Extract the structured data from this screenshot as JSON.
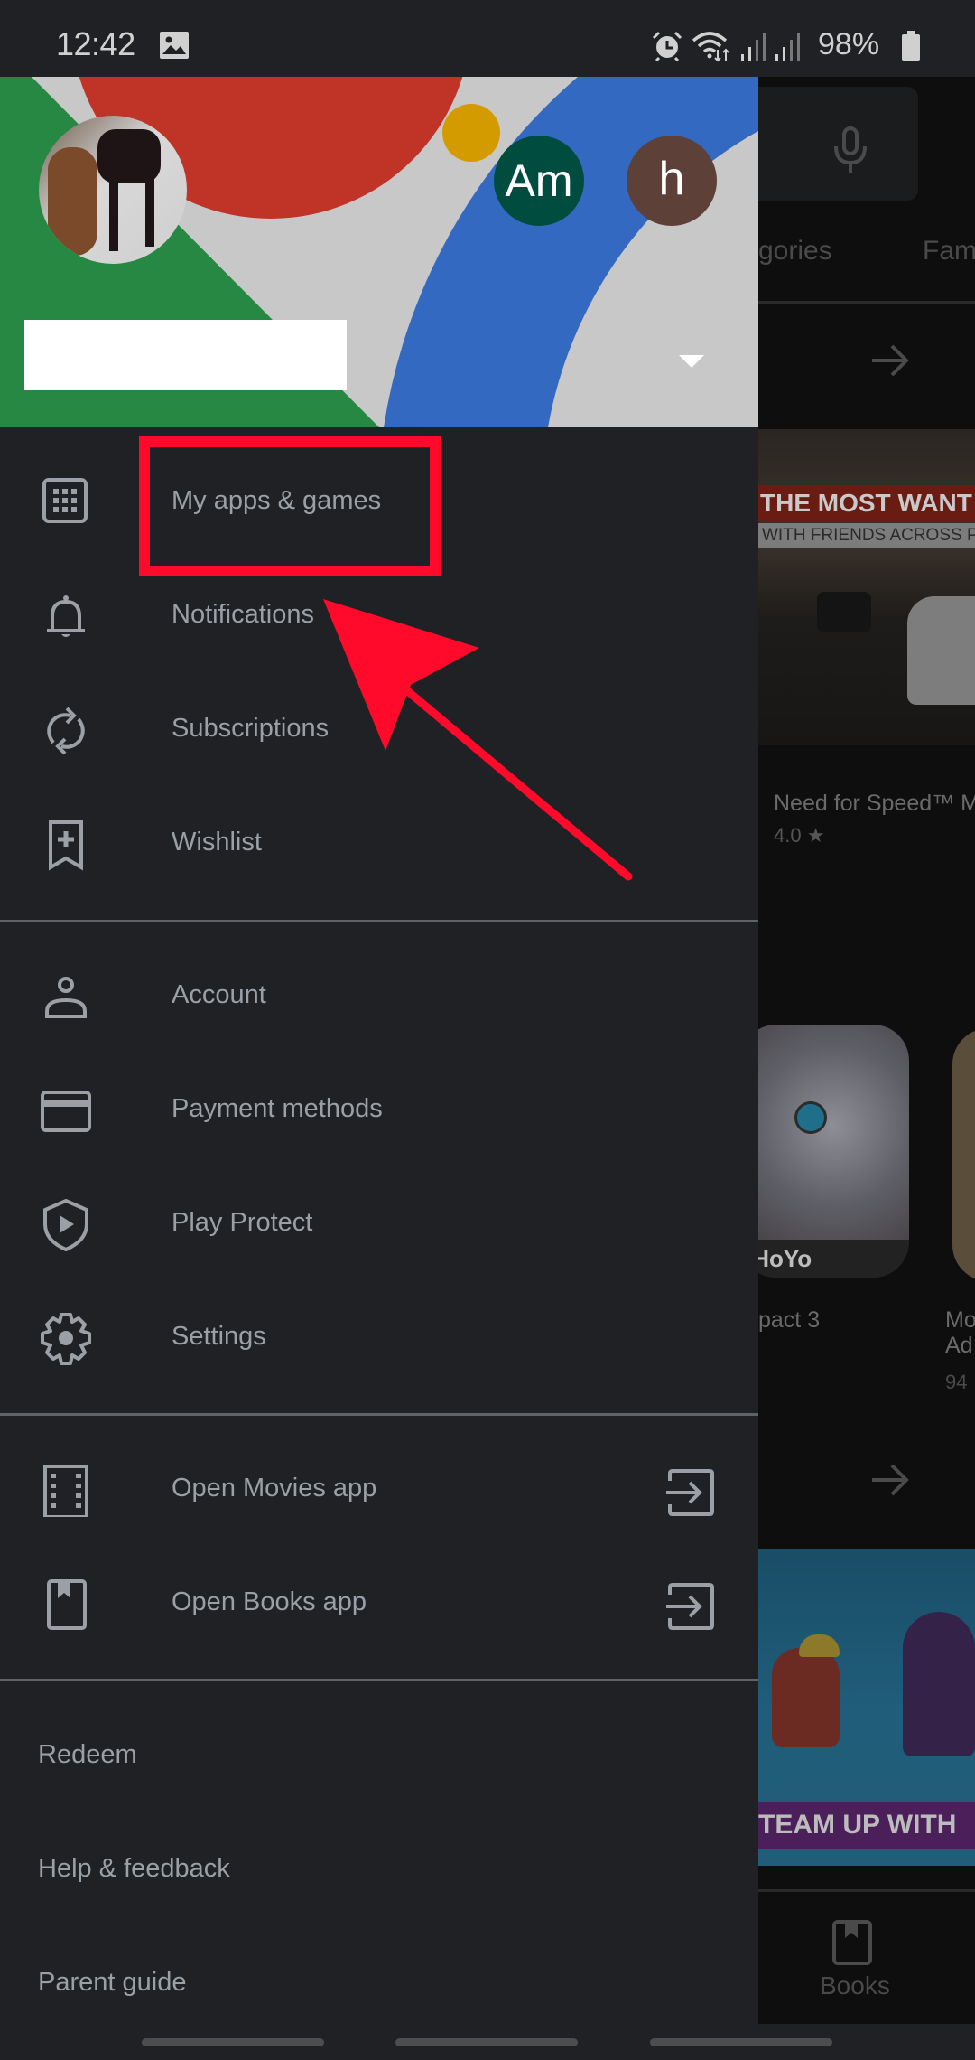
{
  "status_bar": {
    "time": "12:42",
    "notification_icons": [
      "image-icon"
    ],
    "system_icons": [
      "alarm-icon",
      "wifi-icon",
      "signal-icon",
      "signal-icon"
    ],
    "battery_percent": "98%"
  },
  "drawer": {
    "header": {
      "account_avatars": [
        {
          "initials": "Am",
          "color": "#004d40"
        },
        {
          "initials": "h",
          "color": "#5d4037"
        }
      ],
      "account_name": "",
      "switch_account_icon": "dropdown-triangle-icon"
    },
    "sections": [
      {
        "items": [
          {
            "label": "My apps & games",
            "icon": "apps-grid-icon"
          },
          {
            "label": "Notifications",
            "icon": "bell-icon"
          },
          {
            "label": "Subscriptions",
            "icon": "sync-icon"
          },
          {
            "label": "Wishlist",
            "icon": "bookmark-add-icon"
          }
        ]
      },
      {
        "items": [
          {
            "label": "Account",
            "icon": "person-icon"
          },
          {
            "label": "Payment methods",
            "icon": "credit-card-icon"
          },
          {
            "label": "Play Protect",
            "icon": "shield-play-icon"
          },
          {
            "label": "Settings",
            "icon": "gear-icon"
          }
        ]
      },
      {
        "items": [
          {
            "label": "Open Movies app",
            "icon": "film-icon",
            "trailing_icon": "exit-app-icon"
          },
          {
            "label": "Open Books app",
            "icon": "book-icon",
            "trailing_icon": "exit-app-icon"
          }
        ]
      },
      {
        "items": [
          {
            "label": "Redeem"
          },
          {
            "label": "Help & feedback"
          },
          {
            "label": "Parent guide"
          }
        ]
      }
    ]
  },
  "background_page": {
    "search_mic_icon": "mic-icon",
    "tabs": [
      "gories",
      "Fami"
    ],
    "featured": {
      "banner_line1": "THE MOST WANT",
      "banner_line2": "WITH FRIENDS ACROSS PLA",
      "title": "Need for Speed™ Mo",
      "rating": "4.0 ★"
    },
    "apps": [
      {
        "title_lines": [
          "pact 3"
        ],
        "icon_logo": "iHoYo"
      },
      {
        "title_lines": [
          "Mo",
          "Ad"
        ],
        "rating": "94"
      }
    ],
    "promo_banner": "TEAM UP WITH",
    "bottom_nav": {
      "label": "Books",
      "icon": "book-icon"
    }
  },
  "annotation": {
    "color": "#ff0a2b",
    "highlight_target": "My apps & games",
    "shapes": [
      "rectangle",
      "arrow"
    ]
  }
}
